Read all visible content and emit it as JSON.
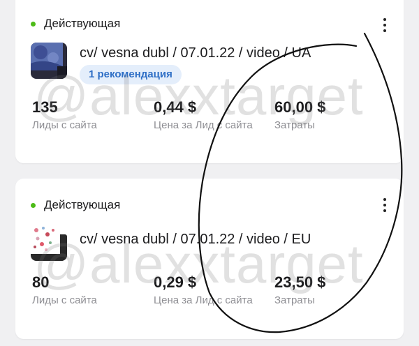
{
  "cards": [
    {
      "status": "Действующая",
      "title": "cv/ vesna dubl / 07.01.22 / video / UA",
      "badge": "1 рекомендация",
      "metrics": [
        {
          "value": "135",
          "label": "Лиды с сайта"
        },
        {
          "value": "0,44 $",
          "label": "Цена за Лид с сайта"
        },
        {
          "value": "60,00 $",
          "label": "Затраты"
        }
      ]
    },
    {
      "status": "Действующая",
      "title": "cv/ vesna dubl / 07.01.22 / video / EU",
      "metrics": [
        {
          "value": "80",
          "label": "Лиды с сайта"
        },
        {
          "value": "0,29 $",
          "label": "Цена за Лид с сайта"
        },
        {
          "value": "23,50 $",
          "label": "Затраты"
        }
      ]
    }
  ],
  "watermark": "@alexxtarget",
  "colors": {
    "status_active": "#4cbb17",
    "badge_bg": "#e4eefb",
    "badge_text": "#2f6fc6"
  },
  "icons": {
    "more": "more-vertical-icon",
    "status": "status-dot-icon"
  }
}
